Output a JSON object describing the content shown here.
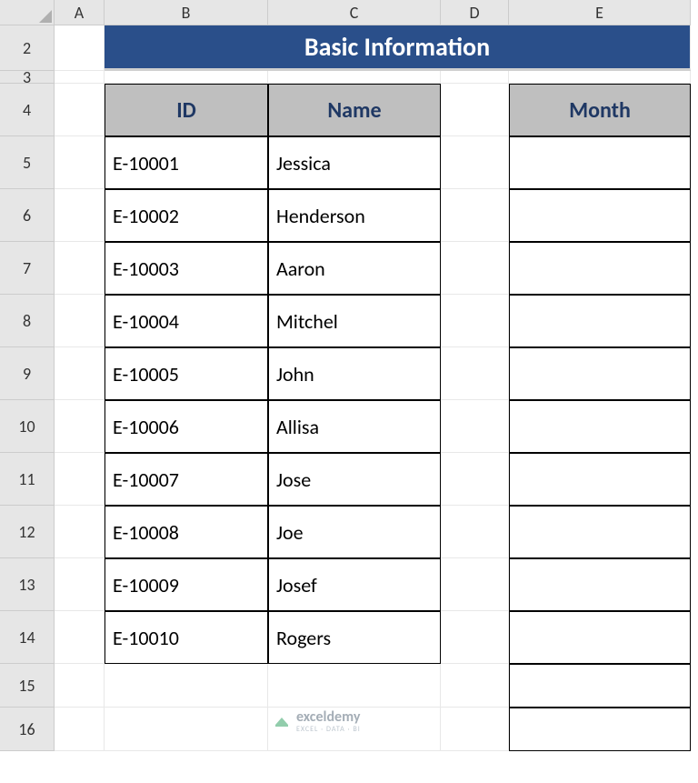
{
  "columns": [
    "A",
    "B",
    "C",
    "D",
    "E"
  ],
  "rows": [
    "2",
    "3",
    "4",
    "5",
    "6",
    "7",
    "8",
    "9",
    "10",
    "11",
    "12",
    "13",
    "14",
    "15",
    "16"
  ],
  "title": "Basic Information",
  "headers": {
    "id": "ID",
    "name": "Name",
    "month": "Month"
  },
  "data": [
    {
      "id": "E-10001",
      "name": "Jessica"
    },
    {
      "id": "E-10002",
      "name": "Henderson"
    },
    {
      "id": "E-10003",
      "name": "Aaron"
    },
    {
      "id": "E-10004",
      "name": "Mitchel"
    },
    {
      "id": "E-10005",
      "name": "John"
    },
    {
      "id": "E-10006",
      "name": "Allisa"
    },
    {
      "id": "E-10007",
      "name": "Jose"
    },
    {
      "id": "E-10008",
      "name": "Joe"
    },
    {
      "id": "E-10009",
      "name": "Josef"
    },
    {
      "id": "E-10010",
      "name": "Rogers"
    }
  ],
  "watermark": {
    "brand": "exceldemy",
    "tagline": "EXCEL · DATA · BI"
  }
}
